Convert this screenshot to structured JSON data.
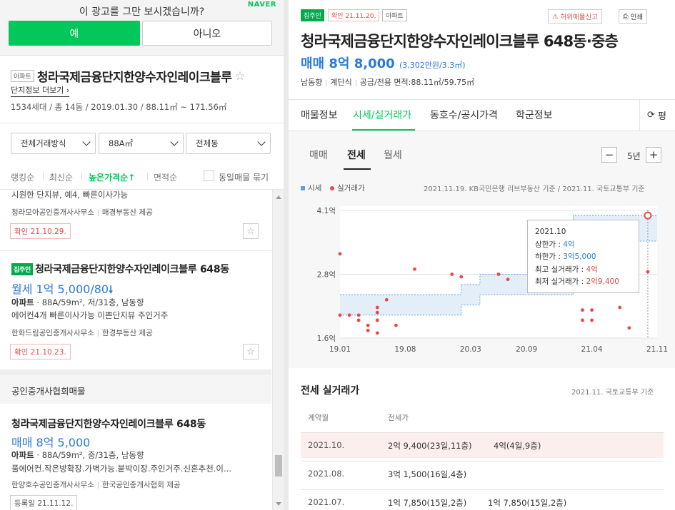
{
  "ad": {
    "question": "이 광고를 그만 보시겠습니까?",
    "brand": "NAVER",
    "yes": "예",
    "no": "아니오"
  },
  "complex": {
    "tag": "아파트",
    "name": "청라국제금융단지한양수자인레이크블루",
    "more": "단지정보 더보기",
    "info": "1534세대 / 총 14동 / 2019.01.30 / 88.11㎡ ~ 171.56㎡"
  },
  "filters": {
    "trade": "전체거래방식",
    "area": "88A㎡",
    "dong": "전체동"
  },
  "sort": {
    "items": [
      "랭킹순",
      "최신순",
      "높은가격순↑",
      "면적순"
    ],
    "active_index": 2,
    "group_label": "동일매물 묶기"
  },
  "listings": {
    "item0": {
      "text": "시원한 단지뷰, 예4, 빠른이사가능",
      "agent": "청라모아공인중개사사무소",
      "provider": "매경부동산 제공",
      "confirm": "확인 21.10.29."
    },
    "item1": {
      "badge": "집주인",
      "title": "청라국제금융단지한양수자인레이크블루 648동",
      "price": "월세 1억 5,000/80",
      "type": "아파트",
      "type_detail": "· 88A/59m², 저/31층, 남동향",
      "desc": "에어컨4개 빠른이사가능 이쁜단지뷰 주인거주",
      "agent": "한화드림공인중개사사무소",
      "provider": "한경부동산 제공",
      "confirm": "확인 21.10.23."
    },
    "section_title": "공인중개사협회매물",
    "item2": {
      "title": "청라국제금융단지한양수자인레이크블루 648동",
      "price": "매매 8억 5,000",
      "type": "아파트",
      "type_detail": "· 88A/59m², 중/31층, 남동향",
      "desc": "풀에어컨.작은방확장.가벽가능.붙박이장.주인거주.신혼추천.이...",
      "agent": "한양호수공인중개사사무소",
      "provider": "한국공인중개사협회 제공",
      "registered": "등록일 21.11.12."
    }
  },
  "detail": {
    "badge_owner": "집주인",
    "badge_confirm": "확인 21.11.20.",
    "badge_type": "아파트",
    "report": "허위매물신고",
    "print": "인쇄",
    "title": "청라국제금융단지한양수자인레이크블루 648동·중층",
    "price": "매매 8억 8,000",
    "price_sub": "(3,302만원/3.3㎡)",
    "meta": [
      "남동향",
      "계단식",
      "공급/전용 면적:88.11㎡/59.75㎡"
    ],
    "tabs": [
      "매물정보",
      "시세/실거래가",
      "동호수/공시가격",
      "학군정보"
    ],
    "active_tab": 1,
    "refresh_label": "평",
    "subtabs": [
      "매매",
      "전세",
      "월세"
    ],
    "active_subtab": 1,
    "zoom": "5년",
    "legend_price": "시세",
    "legend_trade": "실거래가",
    "chart_source": "2021.11.19. KB국민은행 리브부동산 기준 / 2021.11. 국토교통부 기준",
    "tooltip": {
      "date": "2021.10",
      "upper_label": "상한가 : ",
      "upper": "4억",
      "lower_label": "하한가 : ",
      "lower": "3억5,000",
      "max_label": "최고 실거래가 : ",
      "max": "4억",
      "min_label": "최저 실거래가 : ",
      "min": "2억9,400"
    },
    "trades_title": "전세 실거래가",
    "trades_source": "2021.11. 국토교통부 기준",
    "table_headers": [
      "계약월",
      "전세가"
    ],
    "rows": [
      {
        "date": "2021.10.",
        "a": "2억 9,400(23일,11층)",
        "b": "4억(4일,9층)"
      },
      {
        "date": "2021.08.",
        "a": "3억 1,500(16일,4층)",
        "b": ""
      },
      {
        "date": "2021.07.",
        "a": "1억 7,850(15일,2층)",
        "b": "1억 7,850(15일,2층)"
      }
    ]
  },
  "chart_data": {
    "type": "line",
    "y_ticks": [
      "4.1억",
      "2.8억",
      "1.6억"
    ],
    "x_ticks": [
      "19.01",
      "19.08",
      "20.03",
      "20.09",
      "21.04",
      "21.11"
    ],
    "ylim": [
      1.6,
      4.1
    ],
    "xlim": [
      "2019-01",
      "2021-11"
    ],
    "legend": [
      "시세",
      "실거래가"
    ],
    "colors": {
      "band": "#5aa0e8",
      "trade": "#ea4848"
    },
    "price_band": [
      {
        "x": "2019-01",
        "low": 2.05,
        "high": 2.45
      },
      {
        "x": "2020-02",
        "low": 2.05,
        "high": 2.45
      },
      {
        "x": "2020-02",
        "low": 2.25,
        "high": 2.65
      },
      {
        "x": "2020-04",
        "low": 2.25,
        "high": 2.65
      },
      {
        "x": "2020-04",
        "low": 2.45,
        "high": 2.85
      },
      {
        "x": "2021-02",
        "low": 2.45,
        "high": 2.85
      },
      {
        "x": "2021-02",
        "low": 3.5,
        "high": 4.0
      },
      {
        "x": "2021-11",
        "low": 3.5,
        "high": 4.0
      }
    ],
    "trades": [
      {
        "x": "2019-01",
        "y": 3.25
      },
      {
        "x": "2019-01",
        "y": 2.05
      },
      {
        "x": "2019-02",
        "y": 2.05
      },
      {
        "x": "2019-03",
        "y": 2.05
      },
      {
        "x": "2019-03",
        "y": 1.95
      },
      {
        "x": "2019-04",
        "y": 1.85
      },
      {
        "x": "2019-04",
        "y": 1.75
      },
      {
        "x": "2019-05",
        "y": 2.2
      },
      {
        "x": "2019-05",
        "y": 2.1
      },
      {
        "x": "2019-05",
        "y": 1.95
      },
      {
        "x": "2019-05",
        "y": 1.7
      },
      {
        "x": "2019-06",
        "y": 2.35
      },
      {
        "x": "2019-07",
        "y": 1.85
      },
      {
        "x": "2019-09",
        "y": 2.95
      },
      {
        "x": "2020-01",
        "y": 2.85
      },
      {
        "x": "2020-02",
        "y": 2.8
      },
      {
        "x": "2020-06",
        "y": 2.85
      },
      {
        "x": "2020-07",
        "y": 2.75
      },
      {
        "x": "2020-12",
        "y": 2.8
      },
      {
        "x": "2021-03",
        "y": 2.15
      },
      {
        "x": "2021-03",
        "y": 1.95
      },
      {
        "x": "2021-04",
        "y": 2.15
      },
      {
        "x": "2021-04",
        "y": 1.95
      },
      {
        "x": "2021-07",
        "y": 2.2
      },
      {
        "x": "2021-08",
        "y": 1.8
      },
      {
        "x": "2021-10",
        "y": 2.9
      },
      {
        "x": "2021-10",
        "y": 4.0
      }
    ]
  }
}
